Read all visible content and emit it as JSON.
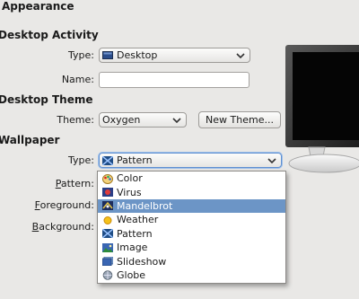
{
  "header": {
    "title": "Appearance"
  },
  "desktop_activity": {
    "heading": "Desktop Activity",
    "type_label": "Type:",
    "type_value": "Desktop",
    "name_label": "Name:",
    "name_value": ""
  },
  "desktop_theme": {
    "heading": "Desktop Theme",
    "theme_label": "Theme:",
    "theme_value": "Oxygen",
    "new_theme_button": "New Theme..."
  },
  "wallpaper": {
    "heading": "Wallpaper",
    "type_label": "Type:",
    "type_value": "Pattern",
    "pattern_label": "Pattern:",
    "foreground_label": "Foreground:",
    "background_label": "Background:",
    "options": [
      {
        "label": "Color",
        "icon": "color-palette-icon"
      },
      {
        "label": "Virus",
        "icon": "virus-icon"
      },
      {
        "label": "Mandelbrot",
        "icon": "mandelbrot-icon",
        "selected": true
      },
      {
        "label": "Weather",
        "icon": "weather-icon"
      },
      {
        "label": "Pattern",
        "icon": "pattern-icon"
      },
      {
        "label": "Image",
        "icon": "image-icon"
      },
      {
        "label": "Slideshow",
        "icon": "slideshow-icon"
      },
      {
        "label": "Globe",
        "icon": "globe-icon"
      }
    ]
  },
  "colors": {
    "selection": "#6c95c6",
    "window_bg": "#e9e8e6"
  }
}
